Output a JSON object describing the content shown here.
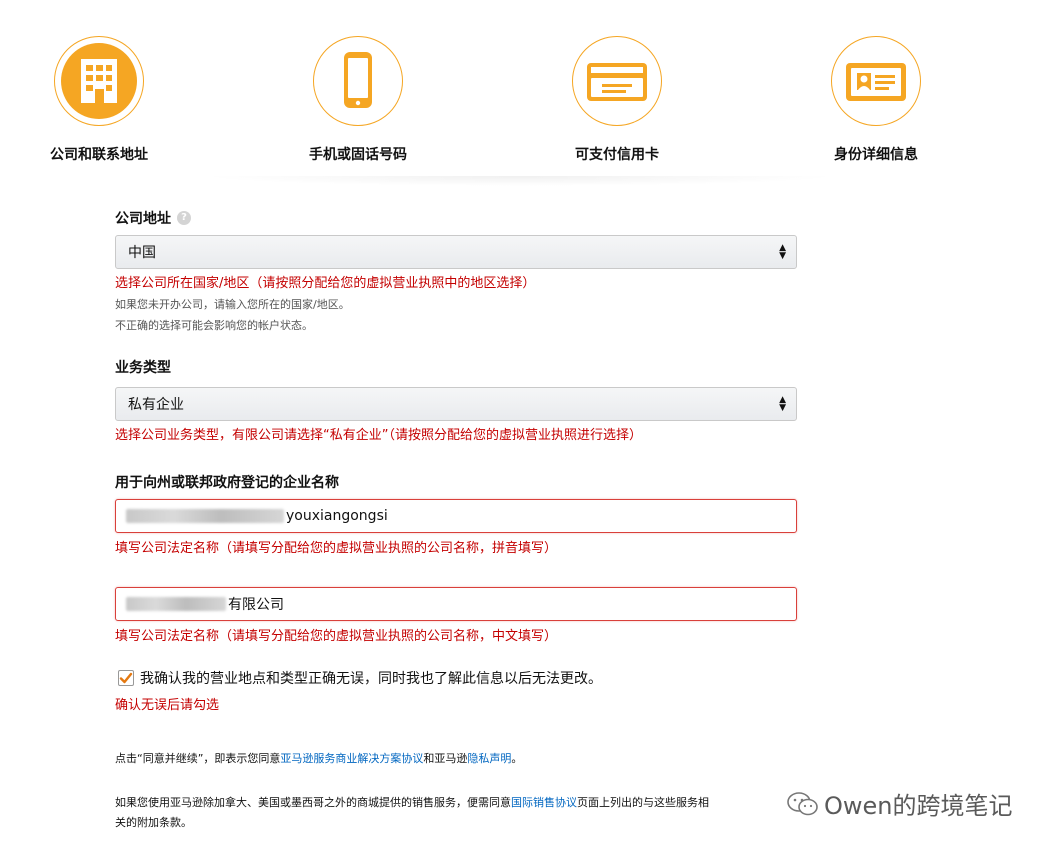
{
  "steps": [
    {
      "label": "公司和联系地址",
      "icon": "building-icon"
    },
    {
      "label": "手机或固话号码",
      "icon": "phone-icon"
    },
    {
      "label": "可支付信用卡",
      "icon": "credit-card-icon"
    },
    {
      "label": "身份详细信息",
      "icon": "id-card-icon"
    }
  ],
  "colors": {
    "accent": "#f5a623",
    "error": "#c40000",
    "link": "#0066c0"
  },
  "company_address": {
    "label": "公司地址",
    "value": "中国",
    "error": "选择公司所在国家/地区（请按照分配给您的虚拟营业执照中的地区选择）",
    "hint1": "如果您未开办公司，请输入您所在的国家/地区。",
    "hint2": "不正确的选择可能会影响您的帐户状态。"
  },
  "business_type": {
    "label": "业务类型",
    "value": "私有企业",
    "error": "选择公司业务类型，有限公司请选择“私有企业”（请按照分配给您的虚拟营业执照进行选择）"
  },
  "business_name": {
    "label": "用于向州或联邦政府登记的企业名称",
    "pinyin_value": "youxiangongsi",
    "pinyin_error": "填写公司法定名称（请填写分配给您的虚拟营业执照的公司名称，拼音填写）",
    "chinese_value": "有限公司",
    "chinese_error": "填写公司法定名称（请填写分配给您的虚拟营业执照的公司名称，中文填写）"
  },
  "confirm": {
    "checked": true,
    "label": "我确认我的营业地点和类型正确无误，同时我也了解此信息以后无法更改。",
    "error": "确认无误后请勾选"
  },
  "legal": {
    "p1_a": "点击“同意并继续”，即表示您同意",
    "p1_link1": "亚马逊服务商业解决方案协议",
    "p1_b": "和亚马逊",
    "p1_link2": "隐私声明",
    "p1_c": "。",
    "p2_a": "如果您使用亚马逊除加拿大、美国或墨西哥之外的商城提供的销售服务，便需同意",
    "p2_link": "国际销售协议",
    "p2_b": "页面上列出的与这些服务相",
    "p2_c": "关的附加条款。"
  },
  "watermark": "Owen的跨境笔记"
}
